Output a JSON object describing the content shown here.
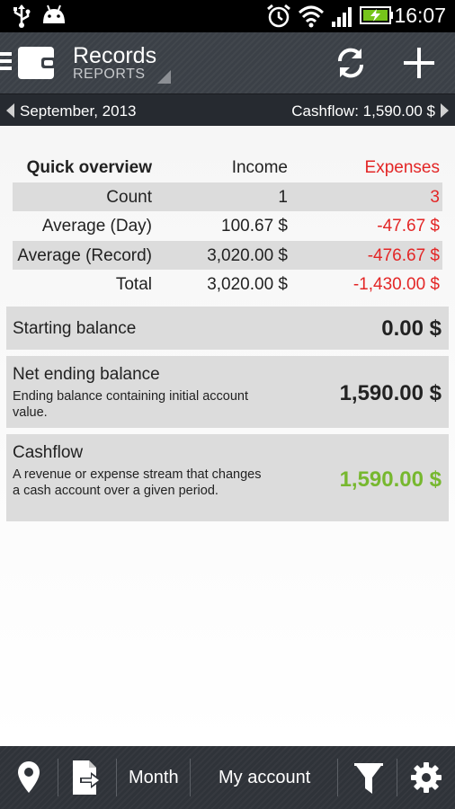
{
  "status_bar": {
    "time": "16:07",
    "icons": [
      "usb-icon",
      "android-icon",
      "alarm-icon",
      "wifi-icon",
      "signal-icon",
      "battery-charging-icon"
    ]
  },
  "action_bar": {
    "title": "Records",
    "subtitle": "REPORTS",
    "icons": [
      "menu-icon",
      "wallet-icon",
      "refresh-icon",
      "add-icon"
    ]
  },
  "period_bar": {
    "period": "September, 2013",
    "cashflow": "Cashflow: 1,590.00 $"
  },
  "overview": {
    "headers": [
      "Quick overview",
      "Income",
      "Expenses"
    ],
    "rows": [
      {
        "label": "Count",
        "income": "1",
        "expenses": "3"
      },
      {
        "label": "Average (Day)",
        "income": "100.67 $",
        "expenses": "-47.67 $"
      },
      {
        "label": "Average (Record)",
        "income": "3,020.00 $",
        "expenses": "-476.67 $"
      },
      {
        "label": "Total",
        "income": "3,020.00 $",
        "expenses": "-1,430.00 $"
      }
    ]
  },
  "starting_balance": {
    "title": "Starting balance",
    "value": "0.00 $"
  },
  "net_ending_balance": {
    "title": "Net ending balance",
    "description": "Ending balance containing initial account value.",
    "value": "1,590.00 $"
  },
  "cashflow_card": {
    "title": "Cashflow",
    "description": "A revenue or expense stream that changes a cash account over a given period.",
    "value": "1,590.00 $"
  },
  "bottom_bar": {
    "period_filter": "Month",
    "account_filter": "My account",
    "icons": [
      "location-icon",
      "export-icon",
      "filter-icon",
      "settings-icon"
    ]
  },
  "colors": {
    "expense_red": "#e32626",
    "cashflow_green": "#77b82f",
    "action_bar": "#3b4047"
  }
}
